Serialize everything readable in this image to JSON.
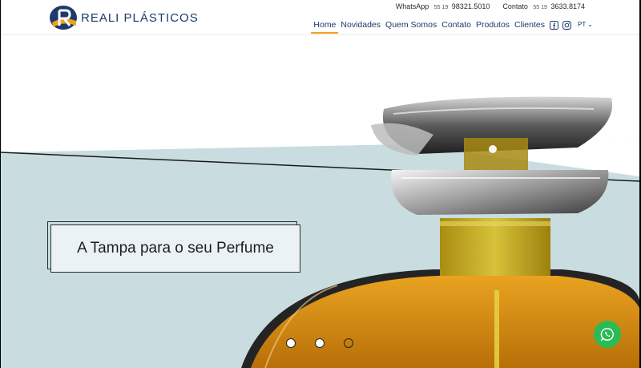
{
  "brand": {
    "name": "REALI PLÁSTICOS"
  },
  "contacts": {
    "whatsapp_label": "WhatsApp",
    "whatsapp_prefix": "55 19",
    "whatsapp_number": "98321.5010",
    "contact_label": "Contato",
    "contact_prefix": "55 19",
    "contact_number": "3633.8174"
  },
  "nav": {
    "items": [
      {
        "label": "Home",
        "active": true
      },
      {
        "label": "Novidades"
      },
      {
        "label": "Quem Somos"
      },
      {
        "label": "Contato"
      },
      {
        "label": "Produtos"
      },
      {
        "label": "Clientes"
      }
    ],
    "language": "PT"
  },
  "hero": {
    "headline": "A Tampa para o seu Perfume",
    "slides": {
      "count": 3,
      "active": 0
    }
  },
  "colors": {
    "brand_blue": "#1d3a6b",
    "brand_orange": "#f0a11a",
    "hero_bg": "#c9dde0",
    "whatsapp_green": "#2bbb55"
  },
  "icons": [
    "facebook-icon",
    "instagram-icon",
    "chevron-down-icon",
    "whatsapp-icon"
  ]
}
